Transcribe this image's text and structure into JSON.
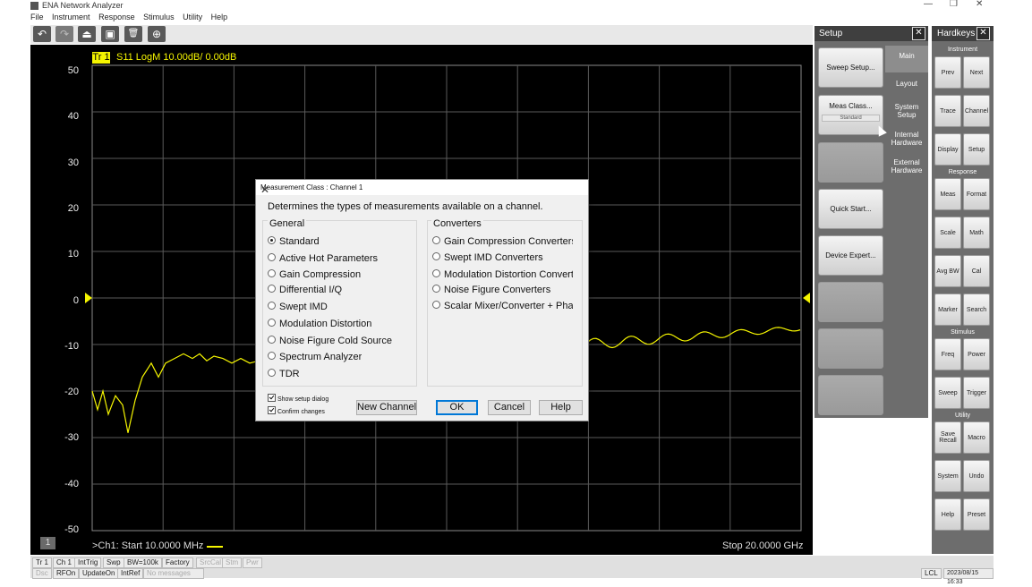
{
  "window": {
    "title": "ENA Network Analyzer",
    "controls": {
      "minimize": "—",
      "restore": "❐",
      "close": "✕"
    }
  },
  "menu": [
    "File",
    "Instrument",
    "Response",
    "Stimulus",
    "Utility",
    "Help"
  ],
  "toolbar": {
    "icons": [
      "undo-icon",
      "redo-icon",
      "marker-icon",
      "screenshot-icon",
      "trash-icon",
      "zoom-icon"
    ],
    "glyphs": [
      "↶",
      "↷",
      "⏏",
      "▣",
      "🗑",
      "⊕"
    ]
  },
  "plot": {
    "trace_tag": "Tr 1",
    "trace_title": "S11 LogM 10.00dB/  0.00dB",
    "y_labels": [
      "50",
      "40",
      "30",
      "20",
      "10",
      "0",
      "-10",
      "-20",
      "-30",
      "-40",
      "-50"
    ],
    "channel_number": "1",
    "start_label": ">Ch1: Start  10.0000 MHz",
    "stop_label": "Stop  20.0000 GHz",
    "trace_color": "#f5f500"
  },
  "setup": {
    "title": "Setup",
    "close": "✕",
    "buttons": [
      {
        "label": "Sweep Setup...",
        "sub": ""
      },
      {
        "label": "Meas Class...",
        "sub": "Standard"
      },
      {
        "label": "",
        "sub": ""
      },
      {
        "label": "Quick Start...",
        "sub": ""
      },
      {
        "label": "Device Expert...",
        "sub": ""
      },
      {
        "label": "",
        "sub": ""
      },
      {
        "label": "",
        "sub": ""
      },
      {
        "label": "",
        "sub": ""
      }
    ],
    "tabs": [
      "Main",
      "Layout",
      "System Setup",
      "Internal Hardware",
      "External Hardware"
    ]
  },
  "hardkeys": {
    "title": "Hardkeys",
    "close": "✕",
    "groups": {
      "instrument": {
        "label": "Instrument",
        "keys": [
          "Prev",
          "Next",
          "Trace",
          "Channel",
          "Display",
          "Setup"
        ]
      },
      "response": {
        "label": "Response",
        "keys": [
          "Meas",
          "Format",
          "Scale",
          "Math",
          "Avg BW",
          "Cal",
          "Marker",
          "Search"
        ]
      },
      "stimulus": {
        "label": "Stimulus",
        "keys": [
          "Freq",
          "Power",
          "Sweep",
          "Trigger"
        ]
      },
      "utility": {
        "label": "Utility",
        "keys": [
          "Save Recall",
          "Macro",
          "System",
          "Undo",
          "Help",
          "Preset"
        ]
      }
    }
  },
  "dialog": {
    "title": "Measurement Class : Channel 1",
    "close": "✕",
    "description": "Determines the types of measurements available on a channel.",
    "general": {
      "header": "General",
      "options": [
        "Standard",
        "Active Hot Parameters",
        "Gain Compression",
        "Differential I/Q",
        "Swept IMD",
        "Modulation Distortion",
        "Noise Figure Cold Source",
        "Spectrum Analyzer",
        "TDR"
      ],
      "selected": 0
    },
    "converters": {
      "header": "Converters",
      "options": [
        "Gain Compression Converters",
        "Swept IMD Converters",
        "Modulation Distortion Converters",
        "Noise Figure Converters",
        "Scalar Mixer/Converter + Phase"
      ]
    },
    "checkboxes": [
      {
        "label": "Show setup dialog",
        "checked": true
      },
      {
        "label": "Confirm changes",
        "checked": true
      }
    ],
    "buttons": {
      "new_channel": "New Channel",
      "ok": "OK",
      "cancel": "Cancel",
      "help": "Help"
    }
  },
  "statusbar": {
    "row1": [
      "Tr 1",
      "Ch 1",
      "IntTrig",
      "Swp",
      "BW=100k",
      "Factory",
      "SrcCal",
      "Stm",
      "Pwr"
    ],
    "row1_dim": [
      false,
      false,
      false,
      false,
      false,
      false,
      true,
      true,
      true
    ],
    "row2": [
      "Dsc",
      "RFOn",
      "UpdateOn",
      "IntRef",
      "No messages"
    ],
    "row2_dim": [
      true,
      false,
      false,
      false,
      true
    ],
    "right": [
      "LCL",
      "2023/08/15 16:33"
    ]
  }
}
